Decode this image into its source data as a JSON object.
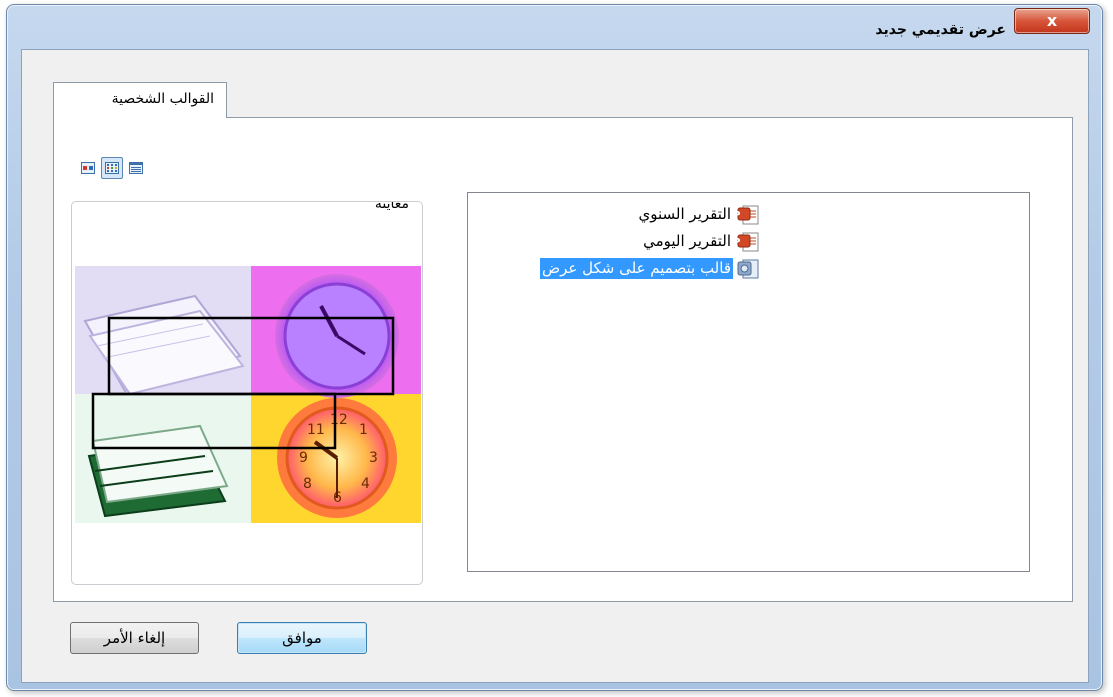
{
  "window": {
    "title": "عرض تقديمي جديد",
    "close_label": "x"
  },
  "tabs": [
    {
      "label": "القوالب الشخصية",
      "selected": true
    }
  ],
  "view_buttons": [
    {
      "icon": "large-icons-view-icon",
      "selected": false
    },
    {
      "icon": "list-view-icon",
      "selected": true
    },
    {
      "icon": "details-view-icon",
      "selected": false
    }
  ],
  "preview": {
    "label": "معاينة"
  },
  "templates": [
    {
      "label": "التقرير السنوي",
      "icon": "powerpoint-file-icon",
      "selected": false
    },
    {
      "label": "التقرير اليومي",
      "icon": "powerpoint-file-icon",
      "selected": false
    },
    {
      "label": "قالب بتصميم على شكل عرض",
      "icon": "design-template-icon",
      "selected": true
    }
  ],
  "buttons": {
    "ok_label": "موافق",
    "cancel_label": "إلغاء الأمر"
  },
  "colors": {
    "selection": "#3399ff",
    "close_button": "#d7553a",
    "frame": "#b3cbe7"
  }
}
